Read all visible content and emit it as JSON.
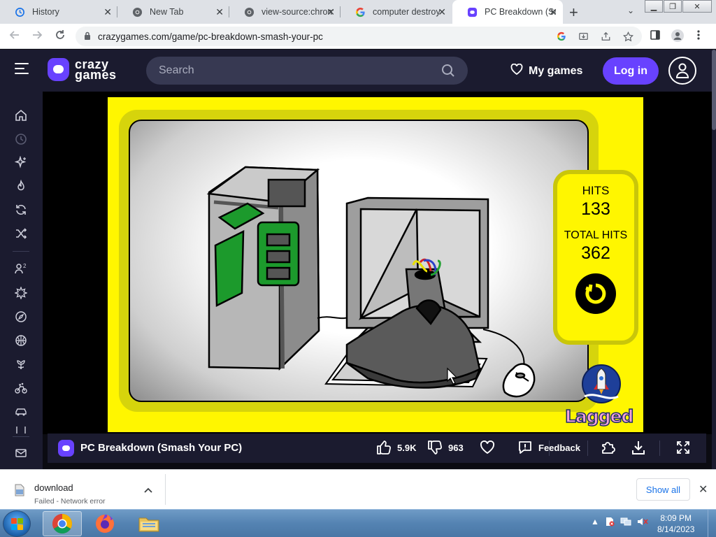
{
  "browser": {
    "tabs": [
      {
        "title": "History",
        "icon": "history-icon"
      },
      {
        "title": "New Tab",
        "icon": "chrome-icon"
      },
      {
        "title": "view-source:chrom",
        "icon": "chrome-icon"
      },
      {
        "title": "computer destroy",
        "icon": "google-icon"
      },
      {
        "title": "PC Breakdown (Sr",
        "icon": "crazygames-icon",
        "active": true
      }
    ],
    "url": "crazygames.com/game/pc-breakdown-smash-your-pc"
  },
  "site": {
    "logo_line1": "crazy",
    "logo_line2": "games",
    "search_placeholder": "Search",
    "my_games_label": "My games",
    "login_label": "Log in",
    "accent_color": "#6842ff"
  },
  "sidebar": {
    "icons": [
      "home-icon",
      "recent-icon",
      "new-icon",
      "trending-icon",
      "updated-icon",
      "random-icon",
      "multiplayer-icon",
      "action-icon",
      "adventure-icon",
      "basketball-icon",
      "casual-icon",
      "bike-icon",
      "car-icon",
      "card-icon",
      "mail-icon"
    ]
  },
  "game": {
    "hud": {
      "hits_label": "HITS",
      "hits_value": "133",
      "total_hits_label": "TOTAL HITS",
      "total_hits_value": "362"
    },
    "publisher": "Lagged"
  },
  "game_bar": {
    "title": "PC Breakdown (Smash Your PC)",
    "likes": "5.9K",
    "dislikes": "963",
    "feedback_label": "Feedback"
  },
  "downloads": {
    "file_name": "download",
    "status": "Failed - Network error",
    "show_all_label": "Show all"
  },
  "taskbar": {
    "time": "8:09 PM",
    "date": "8/14/2023"
  }
}
